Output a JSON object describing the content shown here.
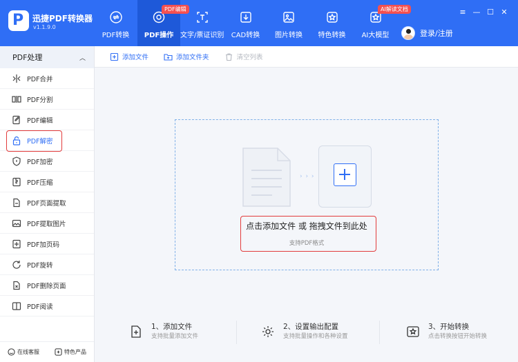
{
  "app": {
    "name": "迅捷PDF转换器",
    "version": "v1.1.9.0"
  },
  "nav": [
    {
      "label": "PDF转换"
    },
    {
      "label": "PDF操作",
      "badge": "PDF编辑",
      "active": true
    },
    {
      "label": "文字/票证识别"
    },
    {
      "label": "CAD转换"
    },
    {
      "label": "图片转换"
    },
    {
      "label": "特色转换"
    },
    {
      "label": "AI大模型",
      "badge": "AI解读文档"
    }
  ],
  "user": {
    "login_label": "登录/注册"
  },
  "window_controls": {
    "menu": "≡",
    "minimize": "—",
    "maximize": "☐",
    "close": "✕"
  },
  "sidebar": {
    "header": "PDF处理",
    "items": [
      {
        "label": "PDF合并",
        "icon": "merge-icon"
      },
      {
        "label": "PDF分割",
        "icon": "split-icon"
      },
      {
        "label": "PDF编辑",
        "icon": "edit-icon"
      },
      {
        "label": "PDF解密",
        "icon": "unlock-icon",
        "active": true
      },
      {
        "label": "PDF加密",
        "icon": "shield-icon"
      },
      {
        "label": "PDF压缩",
        "icon": "compress-icon"
      },
      {
        "label": "PDF页面提取",
        "icon": "page-extract-icon"
      },
      {
        "label": "PDF提取图片",
        "icon": "image-icon"
      },
      {
        "label": "PDF加页码",
        "icon": "page-number-icon"
      },
      {
        "label": "PDF旋转",
        "icon": "rotate-icon"
      },
      {
        "label": "PDF删除页面",
        "icon": "delete-page-icon"
      },
      {
        "label": "PDF阅读",
        "icon": "book-icon"
      }
    ],
    "footer": {
      "support": "在线客服",
      "featured": "特色产品"
    }
  },
  "toolbar": {
    "add_file": "添加文件",
    "add_folder": "添加文件夹",
    "clear_list": "清空列表"
  },
  "dropzone": {
    "title": "点击添加文件 或 拖拽文件到此处",
    "subtitle": "支持PDF格式",
    "arrows": "› › ›"
  },
  "steps": [
    {
      "title": "1、添加文件",
      "desc": "支持批量添加文件"
    },
    {
      "title": "2、设置输出配置",
      "desc": "支持批量操作和各种设置"
    },
    {
      "title": "3、开始转换",
      "desc": "点击转换按钮开始转换"
    }
  ],
  "colors": {
    "brand": "#2f6ef5",
    "nav_active": "#1e59d9",
    "badge": "#f45050",
    "highlight": "#e23b3b",
    "dropzone_border": "#7fb0e8"
  }
}
